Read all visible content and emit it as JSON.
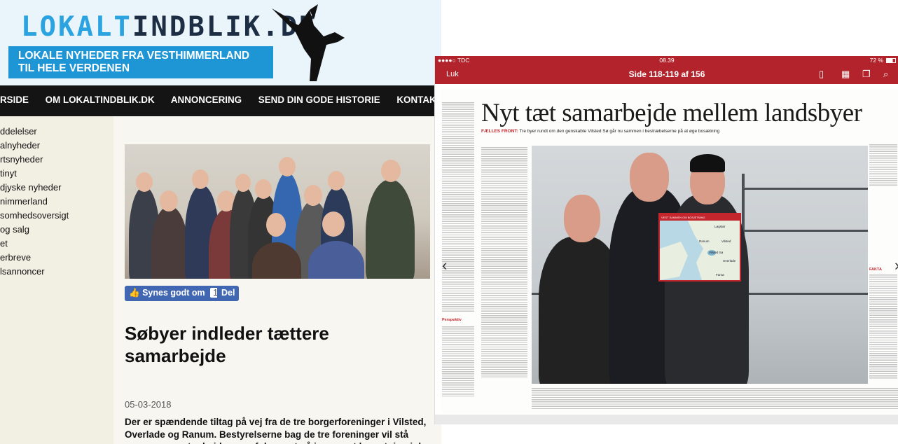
{
  "site": {
    "logo_part1": "LOKALT",
    "logo_part2": "INDBLIK.DK",
    "tagline_line1": "LOKALE NYHEDER FRA VESTHIMMERLAND",
    "tagline_line2": "TIL HELE VERDENEN",
    "nav": [
      "RSIDE",
      "OM LOKALTINDBLIK.DK",
      "ANNONCERING",
      "SEND DIN GODE HISTORIE",
      "KONTAKT LOK"
    ],
    "sidebar": [
      "ddelelser",
      "alnyheder",
      "rtsnyheder",
      "tinyt",
      "djyske nyheder",
      "nimmerland",
      "somhedsoversigt",
      "og salg",
      "et",
      "erbreve",
      "lsannoncer"
    ],
    "like_label": "Synes godt om",
    "like_count": "15",
    "share_label": "Del",
    "article_title": "Søbyer indleder tættere samarbejde",
    "article_date": "05-03-2018",
    "article_lead": "Der er spændende tiltag på vej fra de tre borgerforeninger i Vilsted, Overlade og Ranum. Bestyrelserne bag de tre foreninger vil stå sammen om at arbejde mere fokuseret på især øget bosætning i de tre byer og mere turisme."
  },
  "tablet": {
    "carrier": "●●●●○ TDC",
    "time": "08.39",
    "battery": "72 %",
    "close_label": "Luk",
    "page_label": "Side 118-119 af 156",
    "paper_section": "Perspektiv",
    "paper_headline": "Nyt tæt samarbejde mellem landsbyer",
    "paper_kicker": "FÆLLES FRONT:",
    "paper_deck": "Tre byer rundt om den genskabte Vilsted Sø går nu sammen i bestræbelserne på at øge bosætning",
    "map_title": "VEST SAMMEN OM BOSÆTNING",
    "map_towns": [
      "Løgstør",
      "Ranum",
      "Vilsted",
      "Vilsted Sø",
      "Overlade",
      "Farsø"
    ],
    "side_heading": "FAKTA",
    "perspektiv_label": "Perspektiv"
  },
  "colors": {
    "tablet_red": "#b2232c",
    "site_blue": "#1e96d6",
    "logo_light": "#2aa3e0",
    "logo_dark": "#1c2d44",
    "facebook": "#4267b2"
  }
}
